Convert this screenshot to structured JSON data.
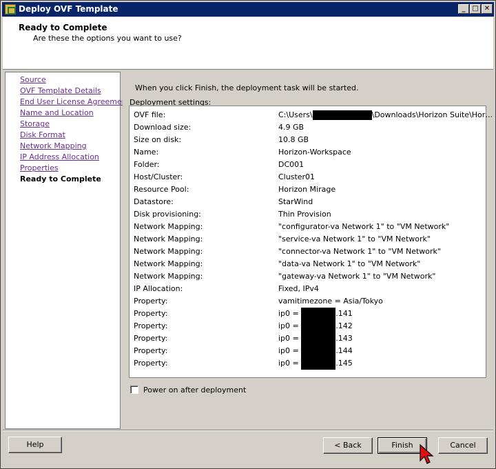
{
  "window": {
    "title": "Deploy OVF Template",
    "controls": {
      "minimize": "_",
      "maximize": "□",
      "close": "✕"
    }
  },
  "header": {
    "title": "Ready to Complete",
    "subtitle": "Are these the options you want to use?"
  },
  "nav": {
    "items": [
      {
        "label": "Source",
        "current": false
      },
      {
        "label": "OVF Template Details",
        "current": false
      },
      {
        "label": "End User License Agreement",
        "current": false
      },
      {
        "label": "Name and Location",
        "current": false
      },
      {
        "label": "Storage",
        "current": false
      },
      {
        "label": "Disk Format",
        "current": false
      },
      {
        "label": "Network Mapping",
        "current": false
      },
      {
        "label": "IP Address Allocation",
        "current": false
      },
      {
        "label": "Properties",
        "current": false
      },
      {
        "label": "Ready to Complete",
        "current": true
      }
    ]
  },
  "main": {
    "intro": "When you click Finish, the deployment task will be started.",
    "settings_label": "Deployment settings:",
    "settings": [
      {
        "key": "OVF file:",
        "pre": "C:\\Users\\",
        "post": "\\Downloads\\Horizon Suite\\Hor…"
      },
      {
        "key": "Download size:",
        "value": "4.9 GB"
      },
      {
        "key": "Size on disk:",
        "value": "10.8 GB"
      },
      {
        "key": "Name:",
        "value": "Horizon-Workspace"
      },
      {
        "key": "Folder:",
        "value": "DC001"
      },
      {
        "key": "Host/Cluster:",
        "value": "Cluster01"
      },
      {
        "key": "Resource Pool:",
        "value": "Horizon Mirage"
      },
      {
        "key": "Datastore:",
        "value": "StarWind"
      },
      {
        "key": "Disk provisioning:",
        "value": "Thin Provision"
      },
      {
        "key": "Network Mapping:",
        "value": "\"configurator-va Network 1\" to \"VM Network\""
      },
      {
        "key": "Network Mapping:",
        "value": "\"service-va Network 1\" to \"VM Network\""
      },
      {
        "key": "Network Mapping:",
        "value": "\"connector-va Network 1\" to \"VM Network\""
      },
      {
        "key": "Network Mapping:",
        "value": "\"data-va Network 1\" to \"VM Network\""
      },
      {
        "key": "Network Mapping:",
        "value": "\"gateway-va Network 1\" to \"VM Network\""
      },
      {
        "key": "IP Allocation:",
        "value": "Fixed, IPv4"
      },
      {
        "key": "Property:",
        "value": "vamitimezone = Asia/Tokyo"
      },
      {
        "key": "Property:",
        "pre": "ip0 = ",
        "post": ".141"
      },
      {
        "key": "Property:",
        "pre": "ip0 = ",
        "post": ".142"
      },
      {
        "key": "Property:",
        "pre": "ip0 = ",
        "post": ".143"
      },
      {
        "key": "Property:",
        "pre": "ip0 = ",
        "post": ".144"
      },
      {
        "key": "Property:",
        "pre": "ip0 = ",
        "post": ".145"
      }
    ],
    "power_on_label": "Power on after deployment",
    "power_on_checked": false
  },
  "footer": {
    "help": "Help",
    "back": "< Back",
    "finish": "Finish",
    "cancel": "Cancel"
  }
}
